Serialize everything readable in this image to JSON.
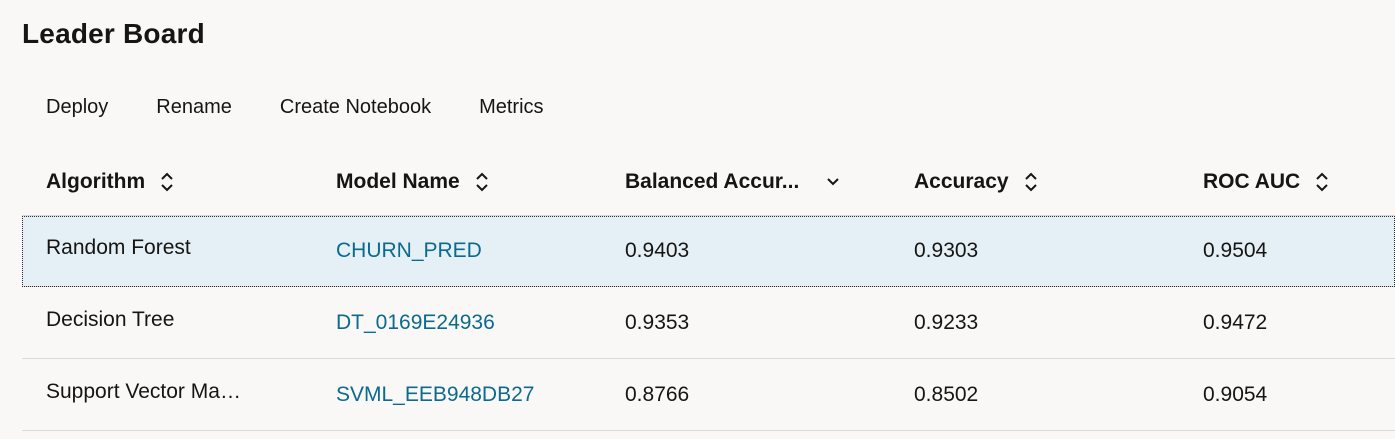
{
  "title": "Leader Board",
  "toolbar": {
    "deploy": "Deploy",
    "rename": "Rename",
    "create_notebook": "Create Notebook",
    "metrics": "Metrics"
  },
  "columns": [
    {
      "label": "Algorithm",
      "sort": "unsorted"
    },
    {
      "label": "Model Name",
      "sort": "unsorted"
    },
    {
      "label": "Balanced Accur...",
      "sort": "descending"
    },
    {
      "label": "Accuracy",
      "sort": "unsorted"
    },
    {
      "label": "ROC AUC",
      "sort": "unsorted"
    }
  ],
  "rows": [
    {
      "algorithm": "Random Forest",
      "model_name": "CHURN_PRED",
      "balanced_accuracy": "0.9403",
      "accuracy": "0.9303",
      "roc_auc": "0.9504",
      "selected": true
    },
    {
      "algorithm": "Decision Tree",
      "model_name": "DT_0169E24936",
      "balanced_accuracy": "0.9353",
      "accuracy": "0.9233",
      "roc_auc": "0.9472",
      "selected": false
    },
    {
      "algorithm": "Support Vector Mac...",
      "model_name": "SVML_EEB948DB27",
      "balanced_accuracy": "0.8766",
      "accuracy": "0.8502",
      "roc_auc": "0.9054",
      "selected": false
    }
  ],
  "colors": {
    "link": "#0c6a8c",
    "selected_row": "#e4f0f5",
    "background": "#f9f8f6"
  },
  "icons": {
    "unsorted": "sort-updown-icon",
    "descending": "chevron-down-icon"
  }
}
